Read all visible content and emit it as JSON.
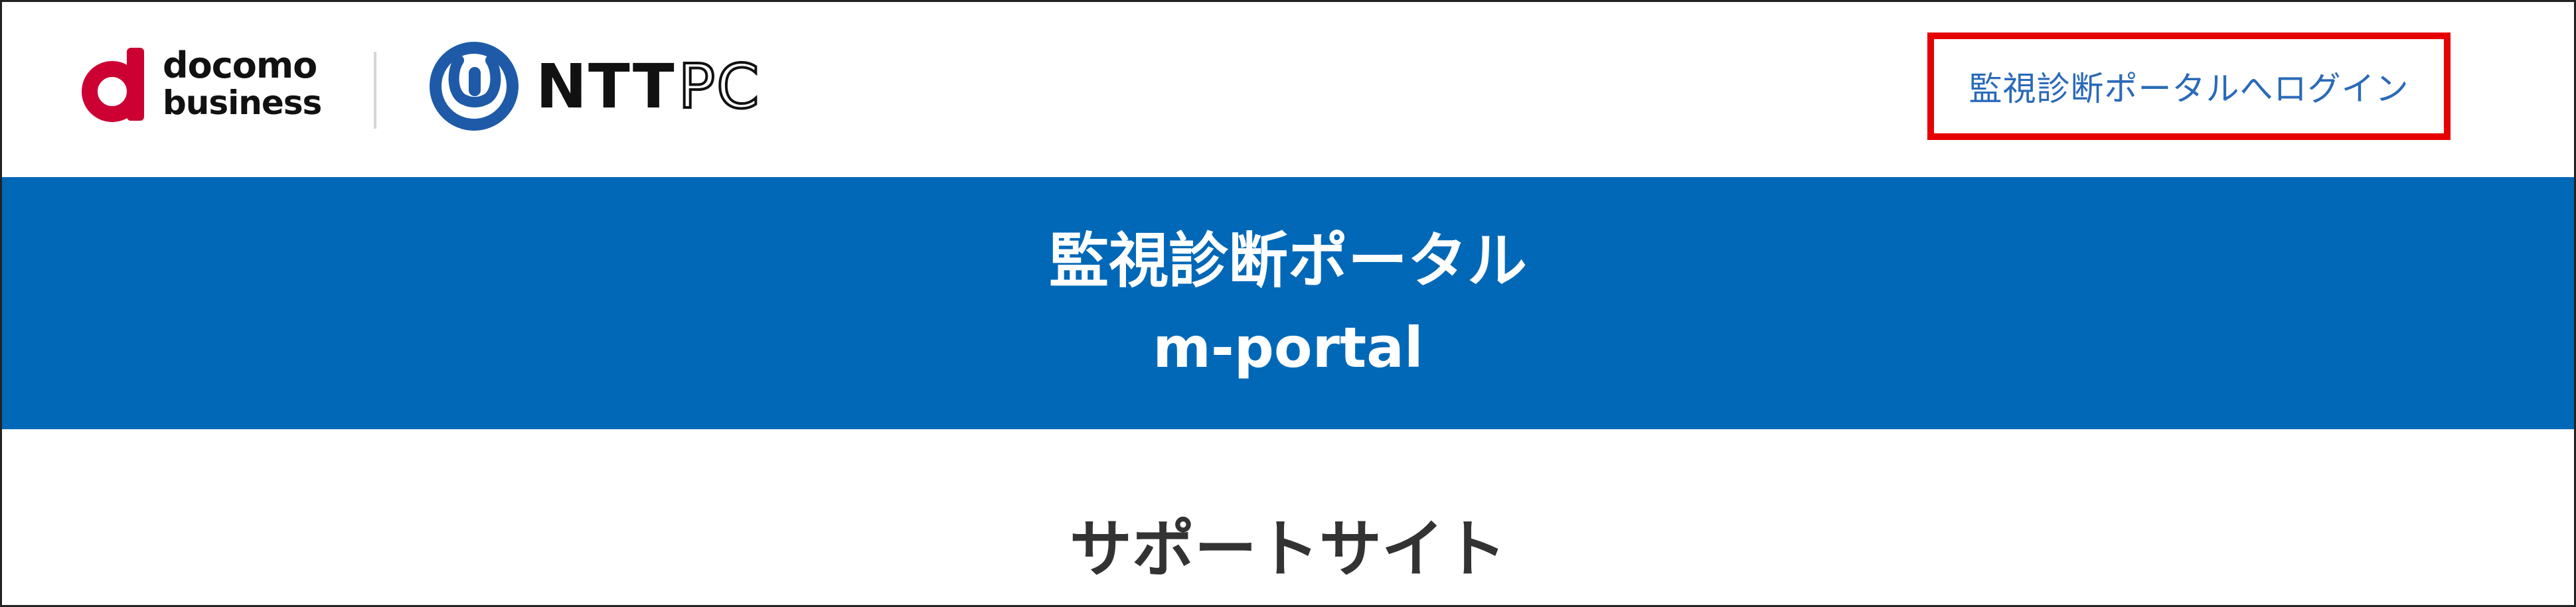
{
  "header": {
    "docomo_logo": {
      "line1": "docomo",
      "line2": "business",
      "mark_color": "#cc0033",
      "text_color": "#111111"
    },
    "ntt_logo": {
      "ntt_text": "NTT",
      "pc_text": "PC",
      "mark_color": "#1e5aa8",
      "text_color": "#111111"
    },
    "login_button_label": "監視診断ポータルへログイン",
    "login_button_text_color": "#2a6ab8",
    "highlight_color": "#e60000"
  },
  "banner": {
    "title": "監視診断ポータル",
    "subtitle": "m-portal",
    "background_color": "#0068b7",
    "text_color": "#ffffff"
  },
  "main": {
    "section_heading": "サポートサイト"
  }
}
